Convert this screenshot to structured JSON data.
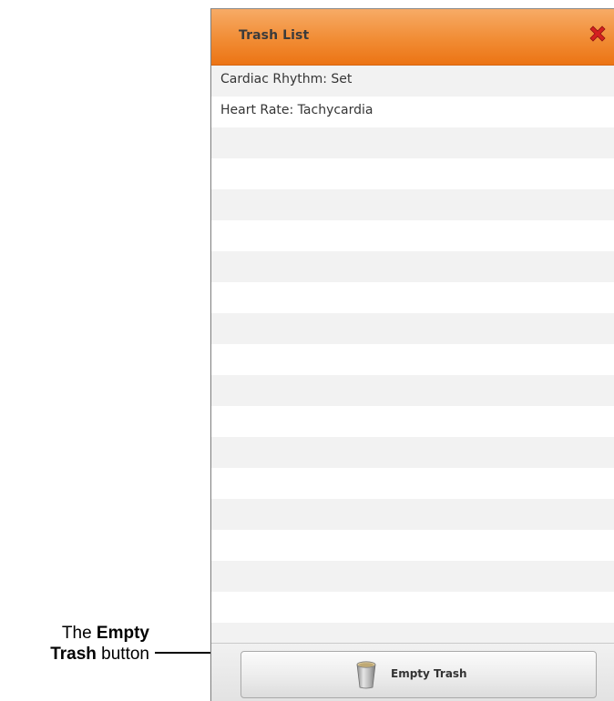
{
  "callout": {
    "line1_prefix": "The ",
    "line1_bold": "Empty",
    "line2_bold": "Trash",
    "line2_suffix": " button"
  },
  "panel": {
    "title": "Trash List",
    "close_icon": "close-x-icon",
    "items": [
      {
        "label": "Cardiac Rhythm: Set"
      },
      {
        "label": "Heart Rate: Tachycardia"
      }
    ],
    "empty_button": {
      "label": "Empty Trash",
      "icon": "trash-can-icon"
    }
  },
  "colors": {
    "header_top": "#f7ab66",
    "header_bottom": "#ec7414",
    "close_icon": "#d42020",
    "row_alt": "#f2f2f2"
  }
}
